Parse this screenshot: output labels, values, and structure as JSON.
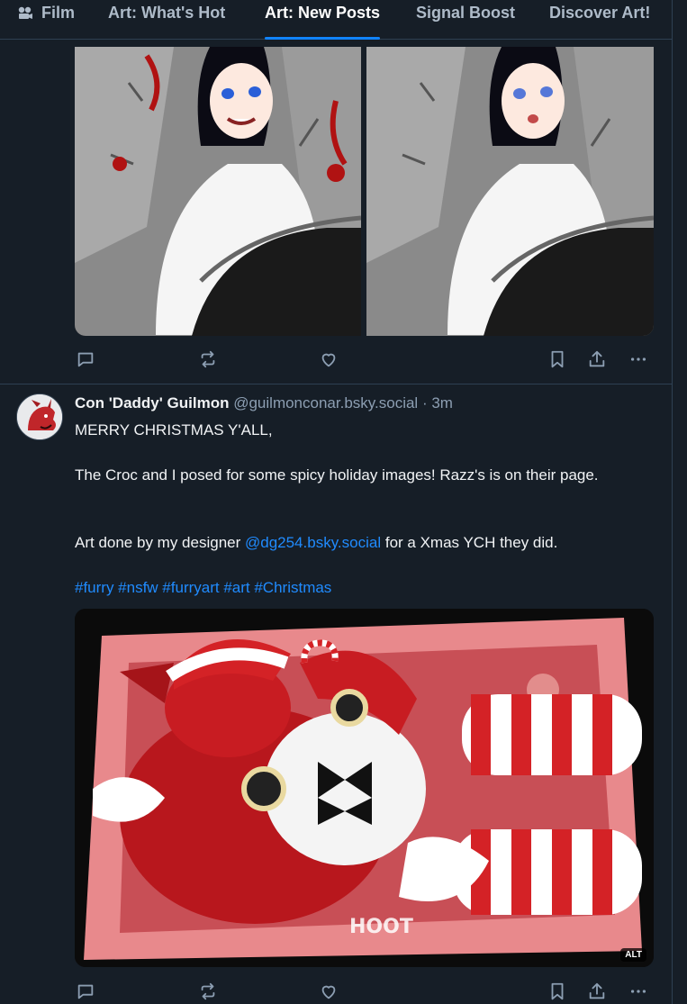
{
  "tabs": [
    {
      "label": "Film",
      "icon": "film-projector-icon"
    },
    {
      "label": "Art: What's Hot"
    },
    {
      "label": "Art: New Posts",
      "active": true
    },
    {
      "label": "Signal Boost"
    },
    {
      "label": "Discover Art!"
    }
  ],
  "post": {
    "author_name": "Con 'Daddy' Guilmon",
    "author_handle": "@guilmonconar.bsky.social",
    "separator": "·",
    "time": "3m",
    "line1": "MERRY CHRISTMAS Y'ALL,",
    "line2": "The Croc and I posed for some spicy holiday images! Razz's is on their page.",
    "line3_before": "Art done by my designer ",
    "line3_mention": "@dg254.bsky.social",
    "line3_after": " for a Xmas YCH they did.",
    "hashtags": "#furry #nsfw #furryart #art #Christmas",
    "image_alt_badge": "ALT"
  },
  "colors": {
    "background": "#161e27",
    "divider": "#2e4052",
    "accent": "#1083fe",
    "muted": "#8c9eb2",
    "link": "#208bfe"
  },
  "action_icons": [
    "reply-icon",
    "repost-icon",
    "like-icon",
    "bookmark-icon",
    "share-icon",
    "more-icon"
  ]
}
